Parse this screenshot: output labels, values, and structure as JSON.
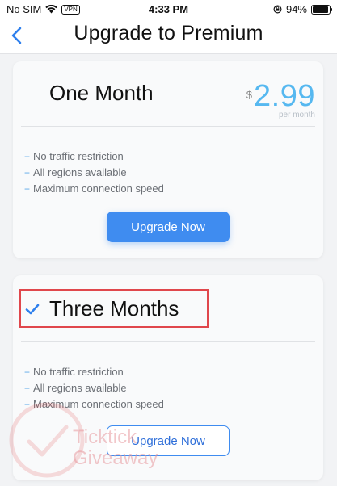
{
  "status_bar": {
    "carrier": "No SIM",
    "vpn": "VPN",
    "time": "4:33 PM",
    "battery_percent": "94%",
    "battery_level": 0.94
  },
  "nav": {
    "title": "Upgrade to Premium"
  },
  "plans": [
    {
      "name": "One Month",
      "currency": "$",
      "price": "2.99",
      "period": "per month",
      "features": [
        "No traffic restriction",
        "All regions available",
        "Maximum connection speed"
      ],
      "button_label": "Upgrade Now"
    },
    {
      "name": "Three Months",
      "features": [
        "No traffic restriction",
        "All regions available",
        "Maximum connection speed"
      ],
      "button_label": "Upgrade Now",
      "selected": true
    }
  ],
  "watermark": {
    "line1": "Ticktick",
    "line2": "Giveaway"
  },
  "colors": {
    "accent": "#3f8cf0",
    "price": "#56b8f0",
    "highlight": "#e0474c"
  }
}
